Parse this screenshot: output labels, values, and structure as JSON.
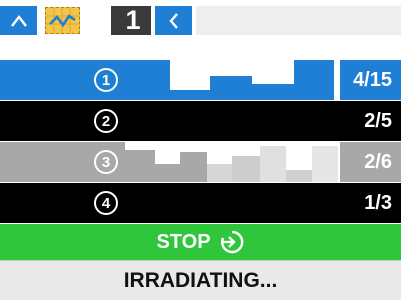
{
  "toolbar": {
    "home_icon": "chevron-up-icon",
    "chart_icon": "line-chart-icon",
    "step_value": "1",
    "back_icon": "chevron-left-icon"
  },
  "rows": [
    {
      "index": "1",
      "count": "4/15",
      "color": "#1f7fd4"
    },
    {
      "index": "2",
      "count": "2/5",
      "color": "#000000"
    },
    {
      "index": "3",
      "count": "2/6",
      "color": "#a8a8a8"
    },
    {
      "index": "4",
      "count": "1/3",
      "color": "#000000"
    }
  ],
  "stop": {
    "label": "STOP",
    "icon": "arrow-circle-right-icon",
    "color": "#2fc63c"
  },
  "status": {
    "text": "IRRADIATING..."
  }
}
